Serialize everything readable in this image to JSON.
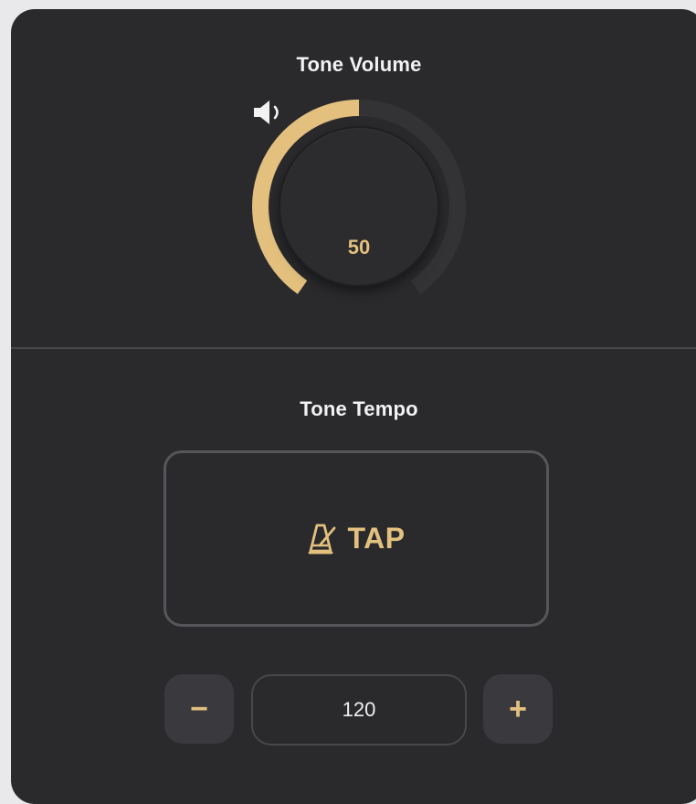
{
  "volume": {
    "title": "Tone Volume",
    "value": "50",
    "level_percent": 50,
    "icon": "speaker-icon"
  },
  "tempo": {
    "title": "Tone Tempo",
    "tap_label": "TAP",
    "tap_icon": "metronome-icon",
    "value": "120",
    "decrement_label": "−",
    "increment_label": "+"
  },
  "colors": {
    "panel_background": "#2a2a2d",
    "accent": "#e3c07e",
    "track": "#333336",
    "button_background": "#3a3a3e"
  }
}
